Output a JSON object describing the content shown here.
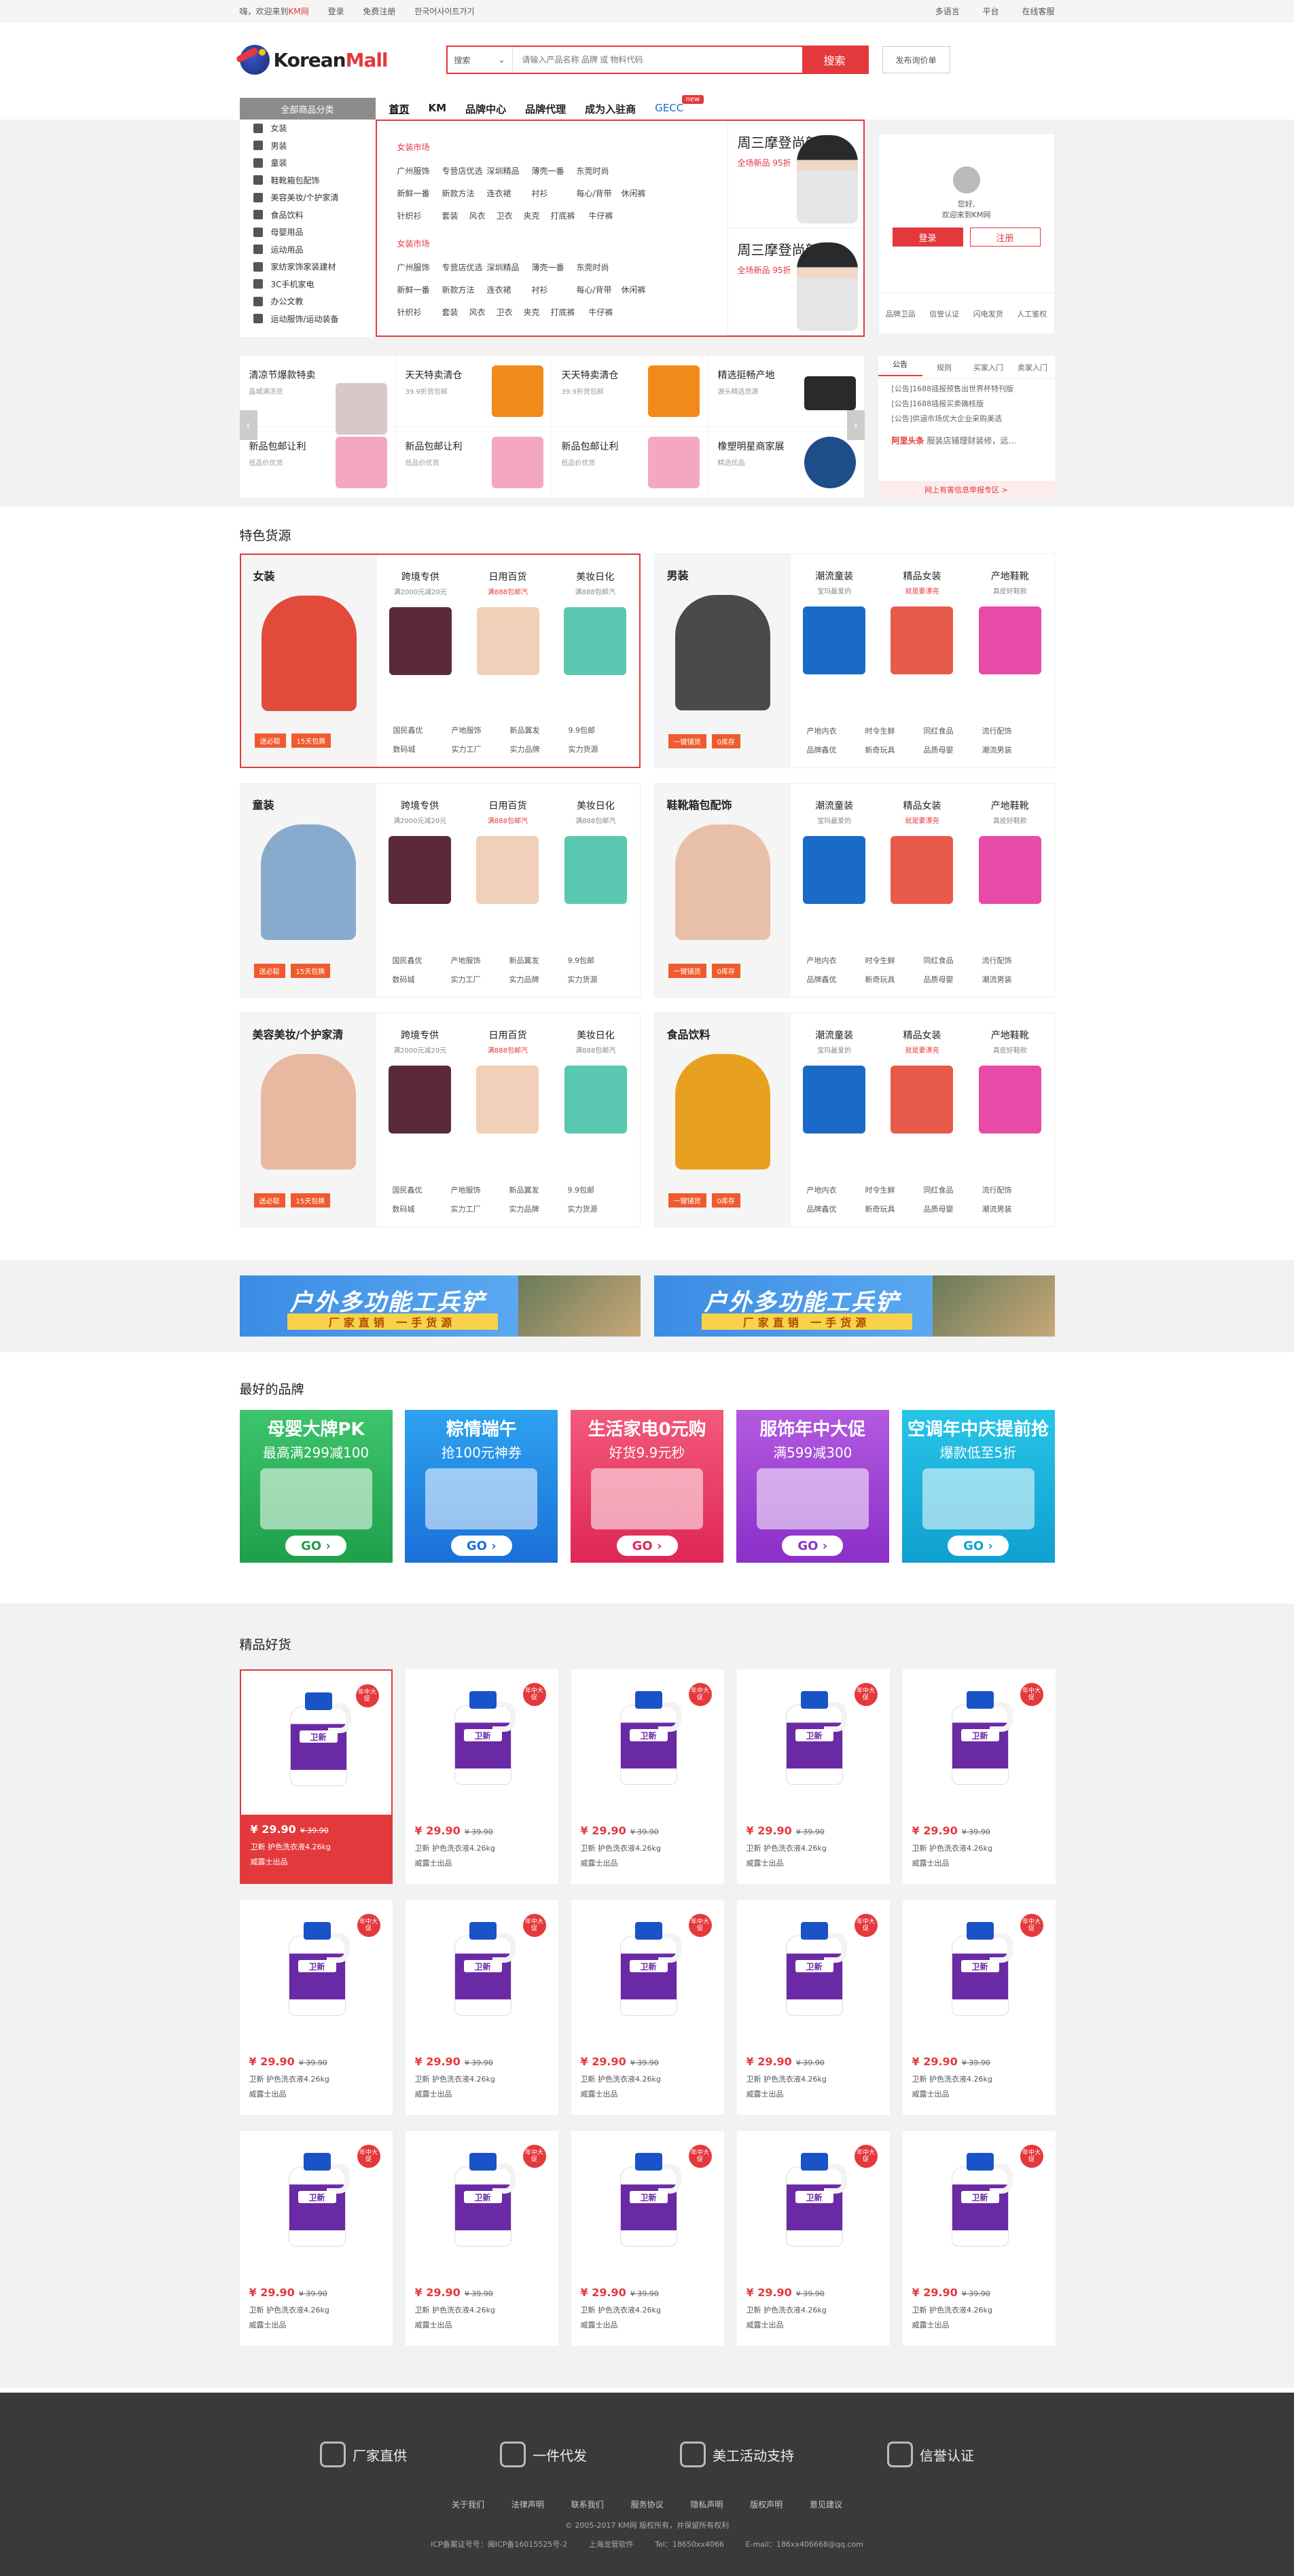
{
  "topbar": {
    "welcome": "嗨，欢迎来到",
    "brand": "KM网",
    "login": "登录",
    "register": "免费注册",
    "korean": "한국어사이트가기",
    "lang": "多语言",
    "platform": "平台",
    "service": "在线客服"
  },
  "header": {
    "logo_k": "Korean",
    "logo_m": "Mall",
    "search_type": "搜索",
    "search_placeholder": "请输入产品名称 品牌 或 物料代码",
    "search_btn": "搜索",
    "publish_btn": "发布询价单"
  },
  "nav": {
    "cat_btn": "全部商品分类",
    "items": [
      "首页",
      "KM",
      "品牌中心",
      "品牌代理",
      "成为入驻商",
      "GECC"
    ],
    "new_badge": "new"
  },
  "categories": [
    "女装",
    "男装",
    "童装",
    "鞋靴箱包配饰",
    "美容美妆/个护家清",
    "食品饮料",
    "母婴用品",
    "运动用品",
    "家纺家饰家装建材",
    "3C手机家电",
    "办公文教",
    "运动服饰/运动装备"
  ],
  "flyout": {
    "groups": [
      {
        "title": "女装市场",
        "rows": [
          [
            "广州服饰",
            "专营店优选",
            "深圳精品",
            "薄壳一番",
            "东莞时尚"
          ],
          [
            "新鲜一番",
            "新款方法",
            "连衣裙",
            "衬衫",
            "每心/背带",
            "休闲裤"
          ],
          [
            "针织衫",
            "套装",
            "风衣",
            "卫衣",
            "夹克",
            "打底裤",
            "牛仔裤"
          ]
        ]
      },
      {
        "title": "女装市场",
        "rows": [
          [
            "广州服饰",
            "专营店优选",
            "深圳精品",
            "薄壳一番",
            "东莞时尚"
          ],
          [
            "新鲜一番",
            "新款方法",
            "连衣裙",
            "衬衫",
            "每心/背带",
            "休闲裤"
          ],
          [
            "针织衫",
            "套装",
            "风衣",
            "卫衣",
            "夹克",
            "打底裤",
            "牛仔裤"
          ]
        ]
      }
    ],
    "ads": [
      {
        "title": "周三摩登尚新",
        "sub": "全场新品 95折"
      },
      {
        "title": "周三摩登尚新",
        "sub": "全场新品 95折"
      }
    ]
  },
  "user": {
    "greeting": "您好,",
    "welcome": "欢迎来到KM网",
    "login": "登录",
    "register": "注册",
    "links": [
      "品牌卫品",
      "信誉认证",
      "闪电发货",
      "人工鉴权"
    ]
  },
  "promo": {
    "cells": [
      {
        "title": "清凉节爆款特卖",
        "sub": "晶城满汤货"
      },
      {
        "title": "天天特卖清仓",
        "sub": "39.9折货包邮"
      },
      {
        "title": "天天特卖清仓",
        "sub": "39.9折货包邮"
      },
      {
        "title": "精选挺畅产地",
        "sub": "源头精选货源"
      },
      {
        "title": "新品包邮让利",
        "sub": "低品价优货"
      },
      {
        "title": "新品包邮让利",
        "sub": "低品价优货"
      },
      {
        "title": "新品包邮让利",
        "sub": "低品价优货"
      },
      {
        "title": "橡塑明星商家展",
        "sub": "精选优品"
      }
    ]
  },
  "notice": {
    "tabs": [
      "公告",
      "规则",
      "买家入门",
      "卖家入门"
    ],
    "items": [
      "[公告]1688插报预售出世界杯特刊版",
      "[公告]1688插报买卖确核版",
      "[公告]供涵市场优大企业采购美选"
    ],
    "hot_label": "阿里头条",
    "hot_text": "服装店铺理财装修，远…",
    "foot": "网上有害信息举报专区 >"
  },
  "feature": {
    "title": "特色货源",
    "cards": [
      {
        "name": "女装",
        "tags": [
          "送必聪",
          "15天包换"
        ]
      },
      {
        "name": "男装",
        "tags": [
          "一键铺货",
          "0库存"
        ]
      },
      {
        "name": "童装",
        "tags": [
          "送必聪",
          "15天包换"
        ]
      },
      {
        "name": "鞋靴箱包配饰",
        "tags": [
          "一键铺货",
          "0库存"
        ]
      },
      {
        "name": "美容美妆/个护家清",
        "tags": [
          "送必聪",
          "15天包换"
        ]
      },
      {
        "name": "食品饮料",
        "tags": [
          "一键铺货",
          "0库存"
        ]
      }
    ],
    "prodsA": [
      {
        "t": "跨境专供",
        "s": "满2000元减20元",
        "red": false
      },
      {
        "t": "日用百货",
        "s": "满888包邮汽",
        "red": true
      },
      {
        "t": "美妆日化",
        "s": "满888包邮汽",
        "red": false
      }
    ],
    "prodsB": [
      {
        "t": "潮流童装",
        "s": "宝玛最爱的",
        "red": false
      },
      {
        "t": "精品女装",
        "s": "就是要漂亮",
        "red": true
      },
      {
        "t": "产地鞋靴",
        "s": "真皮好鞋款",
        "red": false
      }
    ],
    "tagsA": [
      [
        "国民鑫优",
        "产地服饰",
        "新品翼发",
        "9.9包邮"
      ],
      [
        "数码城",
        "实力工厂",
        "实力品牌",
        "实力货源"
      ]
    ],
    "tagsB": [
      [
        "产地内衣",
        "时令生鲜",
        "同红食品",
        "流行配饰"
      ],
      [
        "品牌鑫优",
        "新奇玩具",
        "品质母婴",
        "潮流男装"
      ]
    ]
  },
  "outdoor": {
    "title": "户外多功能工兵铲",
    "bar": "厂家直销 一手货源"
  },
  "brands": {
    "title": "最好的品牌",
    "cards": [
      {
        "t1": "母婴大牌PK",
        "t2": "最高满299减100",
        "go": "GO ›",
        "c1": "#3ec46d",
        "c2": "#1f9f4a"
      },
      {
        "t1": "粽情端午",
        "t2": "抢100元神券",
        "go": "GO ›",
        "c1": "#2ea2f0",
        "c2": "#1a70d8"
      },
      {
        "t1": "生活家电0元购",
        "t2": "好货9.9元秒",
        "go": "GO ›",
        "c1": "#f25a7a",
        "c2": "#e02656"
      },
      {
        "t1": "服饰年中大促",
        "t2": "满599减300",
        "go": "GO ›",
        "c1": "#b35ae0",
        "c2": "#8a2fc8"
      },
      {
        "t1": "空调年中庆提前抢",
        "t2": "爆款低至5折",
        "go": "GO ›",
        "c1": "#28c5e8",
        "c2": "#0f9fd0"
      }
    ]
  },
  "products": {
    "title": "精品好货",
    "price": "¥ 29.90",
    "old": "¥ 39.90",
    "name": "卫新 护色洗衣液4.26kg",
    "brand": "威露士出品",
    "label": "卫新",
    "badge": "年中大促"
  },
  "footer": {
    "features": [
      "厂家直供",
      "一件代发",
      "美工活动支持",
      "信誉认证"
    ],
    "links": [
      "关于我们",
      "法律声明",
      "联系我们",
      "服务协议",
      "隐私声明",
      "版权声明",
      "意见建议"
    ],
    "copy": "© 2005-2017 KM网 版权所有，并保留所有权利",
    "icp": [
      "ICP备案证号号：闽ICP备16015525号-2",
      "上海龙管软件",
      "Tel：18650xx4066",
      "E-mail：186xx406668@qq.com"
    ]
  }
}
